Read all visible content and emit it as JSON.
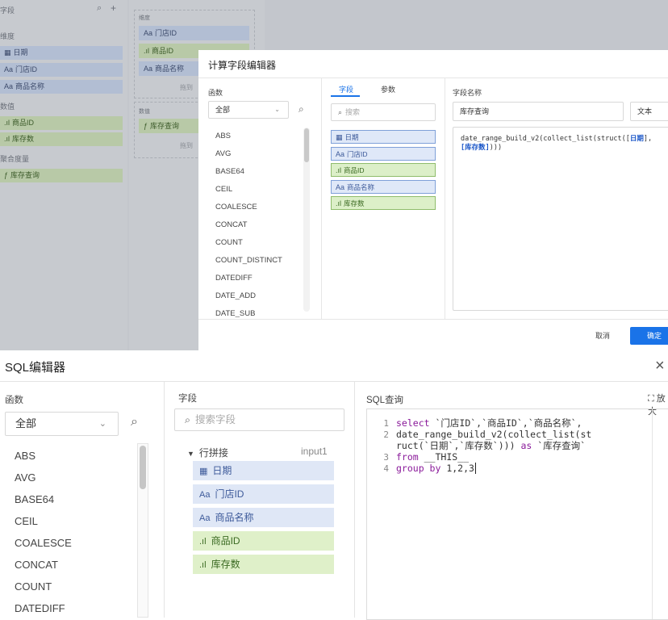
{
  "background": {
    "left_header": "字段",
    "sections": {
      "dimension": "维度",
      "measure": "数值",
      "aggregate": "聚合度量"
    },
    "dimensions": [
      "日期",
      "门店ID",
      "商品名称"
    ],
    "measures": [
      "商品ID",
      "库存数"
    ],
    "aggregates": [
      "库存查询"
    ],
    "mid_dim_label": "维度",
    "mid_measure_label": "数值",
    "mid_dim_items": [
      "门店ID",
      "商品ID",
      "商品名称"
    ],
    "mid_measure_items": [
      "库存查询"
    ],
    "drag_hint": "拖到",
    "drag_hint2": "拖到"
  },
  "calc_editor": {
    "title": "计算字段编辑器",
    "functions_label": "函数",
    "category_select": "全部",
    "functions": [
      "ABS",
      "AVG",
      "BASE64",
      "CEIL",
      "COALESCE",
      "CONCAT",
      "COUNT",
      "COUNT_DISTINCT",
      "DATEDIFF",
      "DATE_ADD",
      "DATE_SUB"
    ],
    "tab_fields": "字段",
    "tab_params": "参数",
    "search_placeholder": "搜索",
    "fields": [
      {
        "label": "日期",
        "type": "date"
      },
      {
        "label": "门店ID",
        "type": "text"
      },
      {
        "label": "商品ID",
        "type": "number"
      },
      {
        "label": "商品名称",
        "type": "text"
      },
      {
        "label": "库存数",
        "type": "number"
      }
    ],
    "field_name_label": "字段名称",
    "field_name_value": "库存查询",
    "field_type_value": "文本",
    "expression_prefix": "date_range_build_v2(collect_list(struct([",
    "expression_ref1": "日期",
    "expression_mid": "],",
    "expression_ref2": "[库存数]",
    "expression_suffix": ")))",
    "cancel_label": "取消",
    "confirm_label": "确定"
  },
  "sql_editor": {
    "title": "SQL编辑器",
    "close_icon": "×",
    "functions_label": "函数",
    "category_select": "全部",
    "functions": [
      "ABS",
      "AVG",
      "BASE64",
      "CEIL",
      "COALESCE",
      "CONCAT",
      "COUNT",
      "DATEDIFF"
    ],
    "fields_label": "字段",
    "search_placeholder": "搜索字段",
    "group_name": "行拼接",
    "group_source": "input1",
    "fields": [
      {
        "label": "日期",
        "type": "date"
      },
      {
        "label": "门店ID",
        "type": "text"
      },
      {
        "label": "商品名称",
        "type": "text"
      },
      {
        "label": "商品ID",
        "type": "number"
      },
      {
        "label": "库存数",
        "type": "number"
      }
    ],
    "query_label": "SQL查询",
    "expand_label": "放大",
    "line_numbers": [
      "1",
      "2",
      "3",
      "4"
    ],
    "code": {
      "l1_kw": "select",
      "l1_rest": " `门店ID`,`商品ID`,`商品名称`,",
      "l2": "date_range_build_v2(collect_list(st",
      "l2b_a": "ruct(`日期`,`库存数`))) ",
      "l2b_kw": "as",
      "l2b_b": " `库存查询`",
      "l3_kw": "from",
      "l3_rest": " __THIS__",
      "l4_kw": "group by",
      "l4_rest": " 1,2,3"
    }
  },
  "colors": {
    "accent": "#1a73e8",
    "blue_chip": "#dfe7f6",
    "green_chip": "#dff0c9",
    "keyword": "#8a1a9a"
  }
}
